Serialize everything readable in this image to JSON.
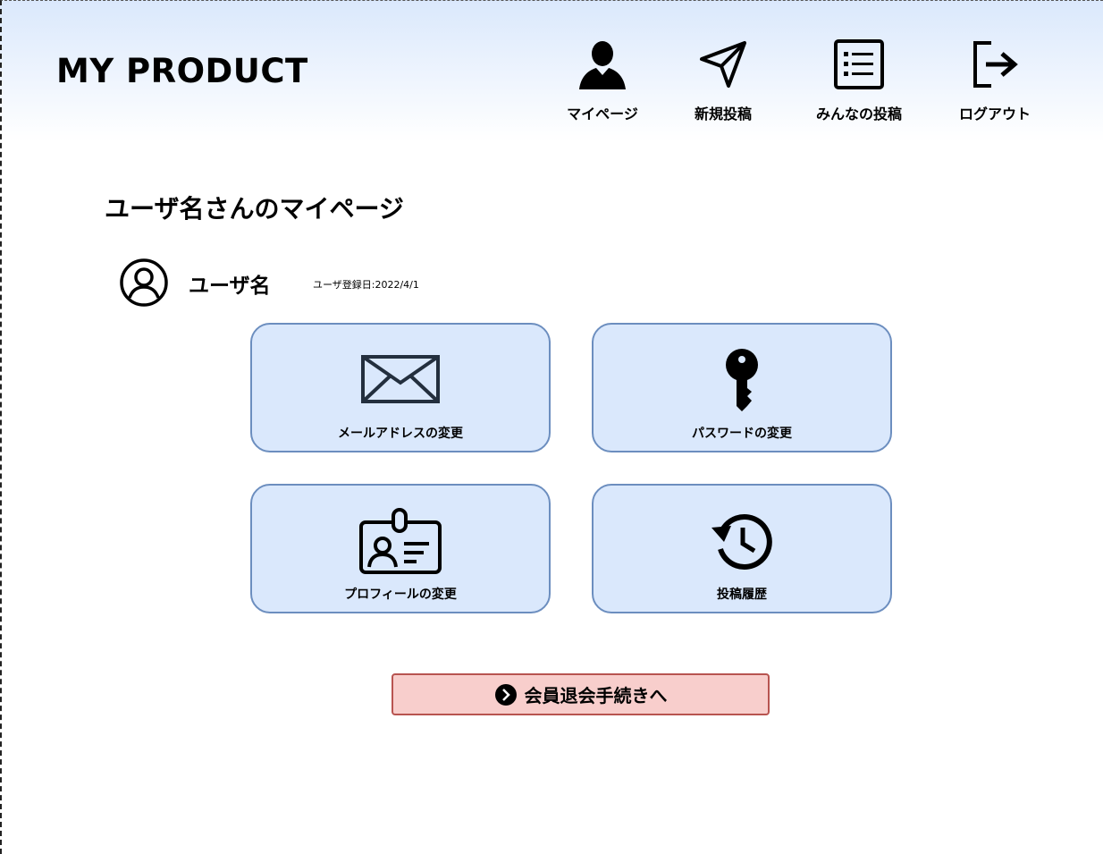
{
  "header": {
    "logo": "MY PRODUCT",
    "nav": [
      {
        "label": "マイページ",
        "icon": "user-icon"
      },
      {
        "label": "新規投稿",
        "icon": "send-icon"
      },
      {
        "label": "みんなの投稿",
        "icon": "list-icon"
      },
      {
        "label": "ログアウト",
        "icon": "logout-icon"
      }
    ]
  },
  "main": {
    "title": "ユーザ名さんのマイページ",
    "user": {
      "name": "ユーザ名",
      "registered": "ユーザ登録日:2022/4/1",
      "avatar_icon": "user-circle-icon"
    },
    "cards": [
      {
        "label": "メールアドレスの変更",
        "icon": "mail-icon"
      },
      {
        "label": "パスワードの変更",
        "icon": "key-icon"
      },
      {
        "label": "プロフィールの変更",
        "icon": "id-card-icon"
      },
      {
        "label": "投稿履歴",
        "icon": "history-icon"
      }
    ],
    "withdraw": {
      "label": "会員退会手続きへ",
      "icon": "chevron-right-circle-icon"
    }
  },
  "colors": {
    "header_gradient_top": "#dae8fc",
    "card_fill": "#dae8fc",
    "card_border": "#6c8ebf",
    "withdraw_fill": "#f8cecc",
    "withdraw_border": "#b85450"
  }
}
